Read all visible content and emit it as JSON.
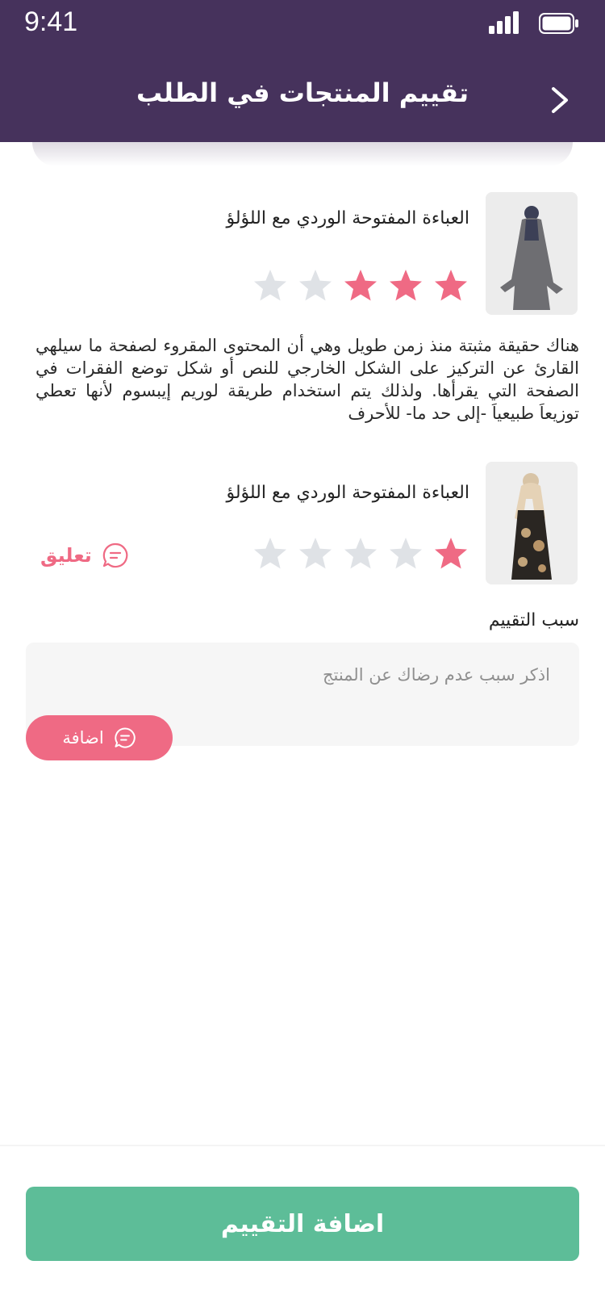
{
  "status_bar": {
    "time": "9:41"
  },
  "header": {
    "title": "تقييم المنتجات في الطلب"
  },
  "products": [
    {
      "name": "العباءة المفتوحة الوردي مع اللؤلؤ",
      "rating": 3,
      "max_rating": 5,
      "review": "هناك حقيقة مثبتة منذ زمن طويل وهي أن المحتوى المقروء لصفحة ما سيلهي القارئ عن التركيز على الشكل الخارجي للنص أو شكل توضع الفقرات في الصفحة التي يقرأها. ولذلك يتم استخدام طريقة لوريم إيبسوم لأنها تعطي توزيعاَ طبيعياَ -إلى حد ما- للأحرف"
    },
    {
      "name": "العباءة المفتوحة الوردي مع اللؤلؤ",
      "rating": 1,
      "max_rating": 5,
      "comment_label": "تعليق"
    }
  ],
  "reason": {
    "label": "سبب التقييم",
    "placeholder": "اذكر سبب عدم رضاك عن المنتج",
    "add_label": "اضافة"
  },
  "submit_label": "اضافة التقييم",
  "colors": {
    "header_bg": "#46325c",
    "accent": "#ef6a84",
    "star_filled": "#ef6a84",
    "star_empty": "#dfe2e6",
    "submit_bg": "#5dbd98"
  },
  "icons": {
    "back": "chevron-right-icon",
    "comment": "chat-bubble-icon",
    "star": "star-icon"
  }
}
